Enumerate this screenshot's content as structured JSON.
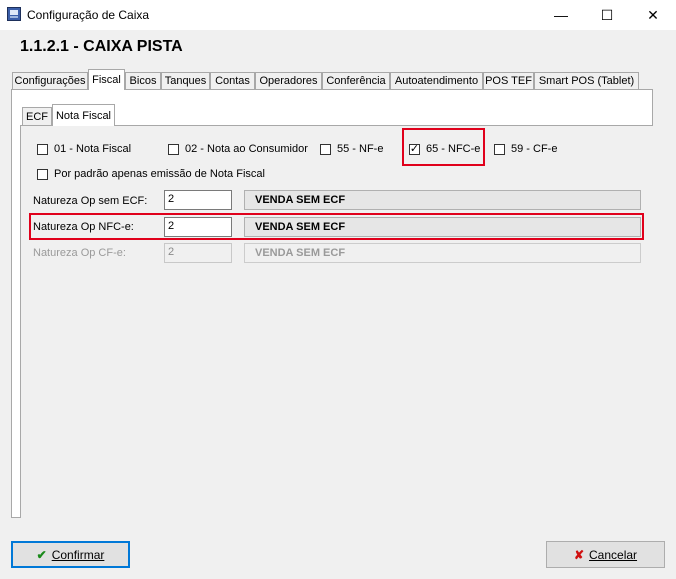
{
  "window": {
    "title": "Configuração de Caixa",
    "minimize_glyph": "—",
    "maximize_glyph": "☐",
    "close_glyph": "✕"
  },
  "heading": "1.1.2.1 - CAIXA PISTA",
  "tabs": [
    "Configurações",
    "Fiscal",
    "Bicos",
    "Tanques",
    "Contas",
    "Operadores",
    "Conferência",
    "Autoatendimento",
    "POS TEF",
    "Smart POS (Tablet)"
  ],
  "subtabs": [
    "ECF",
    "Nota Fiscal"
  ],
  "checkboxes": [
    {
      "label": "01 - Nota Fiscal",
      "checked": false
    },
    {
      "label": "02 - Nota ao Consumidor",
      "checked": false
    },
    {
      "label": "55 - NF-e",
      "checked": false
    },
    {
      "label": "65 - NFC-e",
      "checked": true
    },
    {
      "label": "59 - CF-e",
      "checked": false
    }
  ],
  "default_checkbox": {
    "label": "Por padrão apenas emissão de Nota Fiscal",
    "checked": false
  },
  "fields": [
    {
      "label": "Natureza Op sem ECF:",
      "value": "2",
      "desc": "VENDA SEM ECF",
      "enabled": true
    },
    {
      "label": "Natureza Op NFC-e:",
      "value": "2",
      "desc": "VENDA SEM ECF",
      "enabled": true
    },
    {
      "label": "Natureza Op CF-e:",
      "value": "2",
      "desc": "VENDA SEM ECF",
      "enabled": false
    }
  ],
  "buttons": {
    "confirm": "Confirmar",
    "cancel": "Cancelar"
  },
  "colors": {
    "highlight": "#e0001b",
    "focus": "#0078d7"
  }
}
